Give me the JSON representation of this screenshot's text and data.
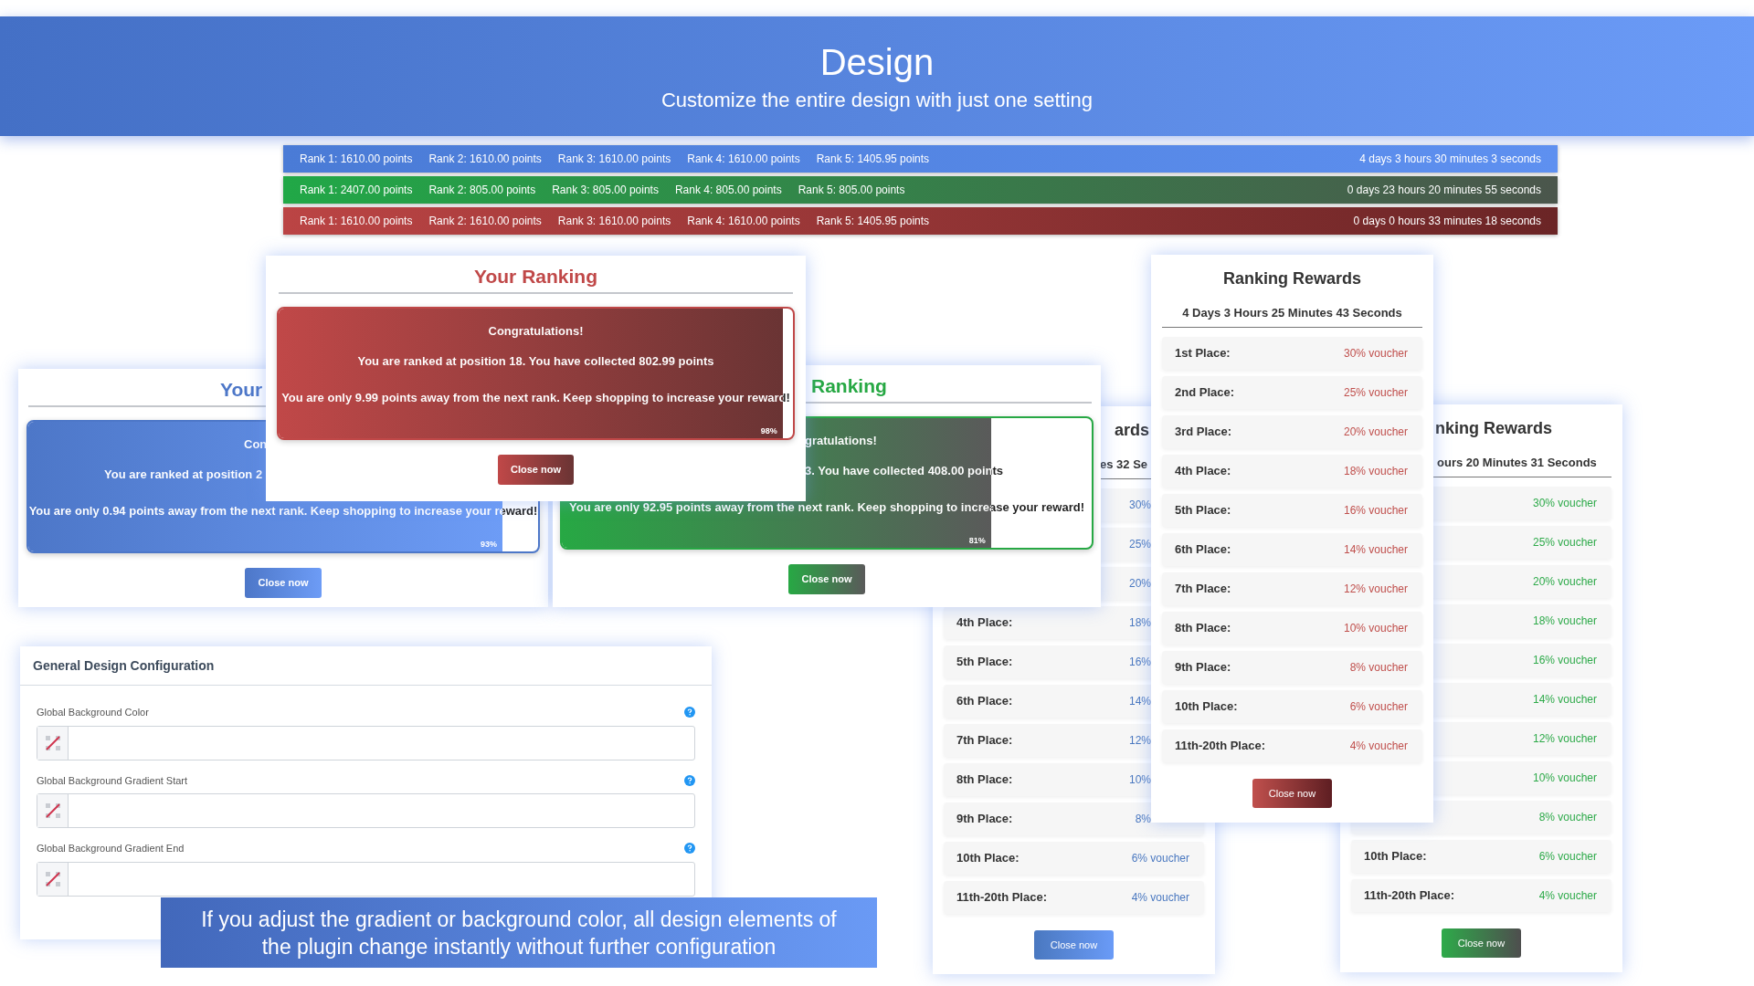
{
  "header": {
    "title": "Design",
    "subtitle": "Customize the entire design with just one setting"
  },
  "countdown_bars": [
    {
      "color": "#4a7bd6",
      "ranks": [
        "Rank 1: 1610.00 points",
        "Rank 2: 1610.00 points",
        "Rank 3: 1610.00 points",
        "Rank 4: 1610.00 points",
        "Rank 5: 1405.95 points"
      ],
      "countdown": "4 days 3 hours 30 minutes 3 seconds"
    },
    {
      "color": "#21a847",
      "ranks": [
        "Rank 1: 2407.00 points",
        "Rank 2: 805.00 points",
        "Rank 3: 805.00 points",
        "Rank 4: 805.00 points",
        "Rank 5: 805.00 points"
      ],
      "countdown": "0 days 23 hours 20 minutes 55 seconds"
    },
    {
      "color": "#bb4444",
      "ranks": [
        "Rank 1: 1610.00 points",
        "Rank 2: 1610.00 points",
        "Rank 3: 1610.00 points",
        "Rank 4: 1610.00 points",
        "Rank 5: 1405.95 points"
      ],
      "countdown": "0 days 0 hours 33 minutes 18 seconds"
    }
  ],
  "ranking_popups": [
    {
      "color": "#4d77c8",
      "title": "Your",
      "lines": [
        "Con",
        "You are ranked at position 2",
        "You are only 0.94 points away from the next rank. Keep shopping to increase your reward!"
      ],
      "level": 0.93,
      "percent": "93%",
      "button": "Close now"
    },
    {
      "color": "#27a844",
      "title": "Ranking",
      "lines": [
        "gratulations!",
        "3. You have collected 408.00 points",
        "You are only 92.95 points away from the next rank. Keep shopping to increase your reward!"
      ],
      "level": 0.81,
      "percent": "81%",
      "button": "Close now"
    },
    {
      "color": "#c04848",
      "title": "Your Ranking",
      "lines": [
        "Congratulations!",
        "You are ranked at position 18. You have collected 802.99 points",
        "You are only 9.99 points away from the next rank. Keep shopping to increase your reward!"
      ],
      "level": 0.98,
      "percent": "98%",
      "button": "Close now"
    }
  ],
  "rewards_panels": [
    {
      "color": "#4a78c0",
      "title": "ards",
      "subtitle": "es 32 Se",
      "rows": [
        {
          "reward": "30%"
        },
        {
          "reward": "25%"
        },
        {
          "reward": "20%"
        },
        {
          "place": "4th Place:",
          "reward": "18%"
        },
        {
          "place": "5th Place:",
          "reward": "16%"
        },
        {
          "place": "6th Place:",
          "reward": "14%"
        },
        {
          "place": "7th Place:",
          "reward": "12%"
        },
        {
          "place": "8th Place:",
          "reward": "10%"
        },
        {
          "place": "9th Place:",
          "reward": "8%"
        },
        {
          "place": "10th Place:",
          "reward": "6% voucher"
        },
        {
          "place": "11th-20th Place:",
          "reward": "4% voucher"
        }
      ],
      "button": "Close now"
    },
    {
      "color": "#c0504d",
      "title": "Ranking Rewards",
      "subtitle": "4 Days 3 Hours 25 Minutes 43 Seconds",
      "rows": [
        {
          "place": "1st Place:",
          "reward": "30% voucher"
        },
        {
          "place": "2nd Place:",
          "reward": "25% voucher"
        },
        {
          "place": "3rd Place:",
          "reward": "20% voucher"
        },
        {
          "place": "4th Place:",
          "reward": "18% voucher"
        },
        {
          "place": "5th Place:",
          "reward": "16% voucher"
        },
        {
          "place": "6th Place:",
          "reward": "14% voucher"
        },
        {
          "place": "7th Place:",
          "reward": "12% voucher"
        },
        {
          "place": "8th Place:",
          "reward": "10% voucher"
        },
        {
          "place": "9th Place:",
          "reward": "8% voucher"
        },
        {
          "place": "10th Place:",
          "reward": "6% voucher"
        },
        {
          "place": "11th-20th Place:",
          "reward": "4% voucher"
        }
      ],
      "button": "Close now"
    },
    {
      "color": "#2eaa4a",
      "title": "nking Rewards",
      "subtitle": "ours 20 Minutes 31 Seconds",
      "rows": [
        {
          "reward": "30% voucher"
        },
        {
          "reward": "25% voucher"
        },
        {
          "reward": "20% voucher"
        },
        {
          "reward": "18% voucher"
        },
        {
          "reward": "16% voucher"
        },
        {
          "reward": "14% voucher"
        },
        {
          "reward": "12% voucher"
        },
        {
          "reward": "10% voucher"
        },
        {
          "reward": "8% voucher"
        },
        {
          "place": "10th Place:",
          "reward": "6% voucher"
        },
        {
          "place": "11th-20th Place:",
          "reward": "4% voucher"
        }
      ],
      "button": "Close now"
    }
  ],
  "config": {
    "title": "General Design Configuration",
    "fields": [
      {
        "label": "Global Background Color"
      },
      {
        "label": "Global Background Gradient Start"
      },
      {
        "label": "Global Background Gradient End"
      }
    ]
  },
  "caption": "If you adjust the gradient or background color, all design elements of the plugin change instantly without further configuration"
}
